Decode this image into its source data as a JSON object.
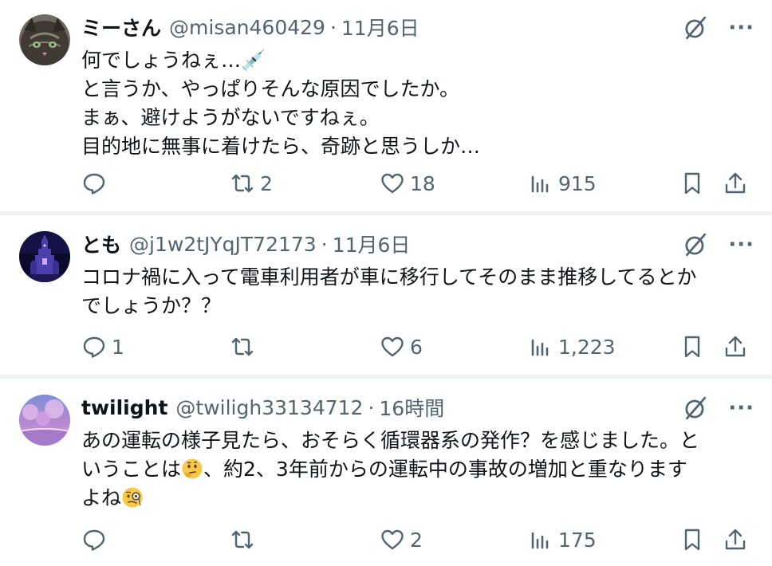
{
  "posts": [
    {
      "author_name": "ミーさん",
      "handle": "@misan460429",
      "separator": "·",
      "time": "11月6日",
      "text": "何でしょうねぇ…💉\nと言うか、やっぱりそんな原因でしたか。\nまぁ、避けようがないですねぇ。\n目的地に無事に着けたら、奇跡と思うしか…",
      "reply_count": "",
      "repost_count": "2",
      "like_count": "18",
      "view_count": "915"
    },
    {
      "author_name": "とも",
      "handle": "@j1w2tJYqJT72173",
      "separator": "·",
      "time": "11月6日",
      "text": "コロナ禍に入って電車利用者が車に移行してそのまま推移してるとか\nでしょうか？？",
      "reply_count": "1",
      "repost_count": "",
      "like_count": "6",
      "view_count": "1,223"
    },
    {
      "author_name": "twilight",
      "handle": "@twiligh33134712",
      "separator": "·",
      "time": "16時間",
      "text_line1": "あの運転の様子見たら、おそらく循環器系の発作？を感じました。と",
      "text_line2_a": "いうことは",
      "text_line2_b": "、約2、3年前からの運転中の事故の増加と重なります",
      "text_line3": "よね",
      "reply_count": "",
      "repost_count": "",
      "like_count": "2",
      "view_count": "175"
    }
  ],
  "icons": {
    "reply": "reply-icon",
    "repost": "repost-icon",
    "like": "like-icon",
    "views": "views-icon",
    "bookmark": "bookmark-icon",
    "share": "share-icon",
    "grok": "grok-icon",
    "more": "more-icon"
  },
  "more_glyph": "···",
  "colors": {
    "text": "#0f1419",
    "secondary": "#536471",
    "separator": "#eff3f4"
  }
}
